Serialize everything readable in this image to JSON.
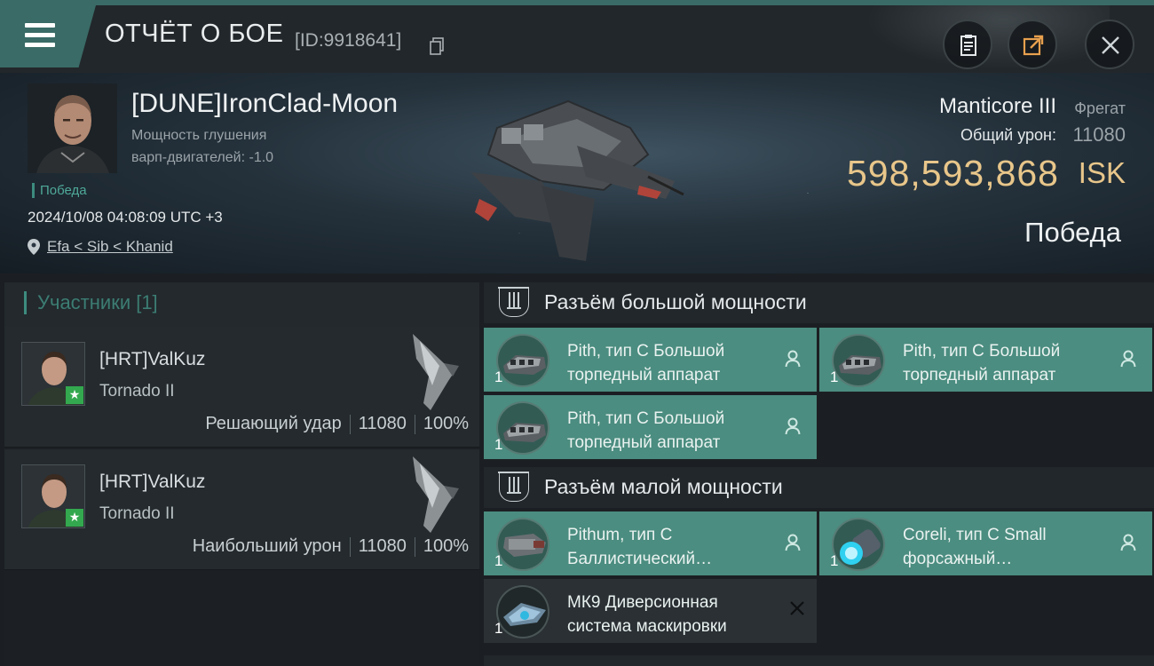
{
  "header": {
    "title": "ОТЧЁТ О БОЕ",
    "report_id": "[ID:9918641]",
    "icons": [
      "menu-icon",
      "copy-icon",
      "clipboard-icon",
      "share-icon",
      "close-icon"
    ]
  },
  "victim": {
    "name": "[DUNE]IronClad-Moon",
    "stat_line1": "Мощность глушения",
    "stat_line2": "варп-двигателей: -1.0",
    "result_small": "Победа",
    "datetime": "2024/10/08 04:08:09 UTC +3",
    "location": "Efa < Sib < Khanid"
  },
  "ship": {
    "name": "Manticore III",
    "class": "Фрегат",
    "damage_label": "Общий урон:",
    "damage_value": "11080",
    "isk_value": "598,593,868",
    "isk_unit": "ISK",
    "result": "Победа"
  },
  "participants": {
    "title": "Участники [1]",
    "rows": [
      {
        "name": "[HRT]ValKuz",
        "ship": "Tornado II",
        "role": "Решающий удар",
        "damage": "11080",
        "percent": "100%"
      },
      {
        "name": "[HRT]ValKuz",
        "ship": "Tornado II",
        "role": "Наибольший урон",
        "damage": "11080",
        "percent": "100%"
      }
    ]
  },
  "high_slots": {
    "title": "Разъём большой мощности",
    "modules": [
      {
        "line1": "Pith, тип C Большой",
        "line2": "торпедный аппарат",
        "qty": "1"
      },
      {
        "line1": "Pith, тип C Большой",
        "line2": "торпедный аппарат",
        "qty": "1"
      },
      {
        "line1": "Pith, тип C Большой",
        "line2": "торпедный аппарат",
        "qty": "1"
      }
    ]
  },
  "low_slots": {
    "title": "Разъём малой мощности",
    "modules": [
      {
        "line1": "Pithum, тип C",
        "line2": "Баллистический…",
        "qty": "1"
      },
      {
        "line1": "Coreli, тип C Small",
        "line2": "форсажный…",
        "qty": "1"
      },
      {
        "line1": "МК9 Диверсионная",
        "line2": "система маскировки",
        "qty": "1"
      }
    ]
  },
  "colors": {
    "accent": "#3a6b66",
    "module_bg": "#4b8d80",
    "isk": "#e8c68a"
  }
}
